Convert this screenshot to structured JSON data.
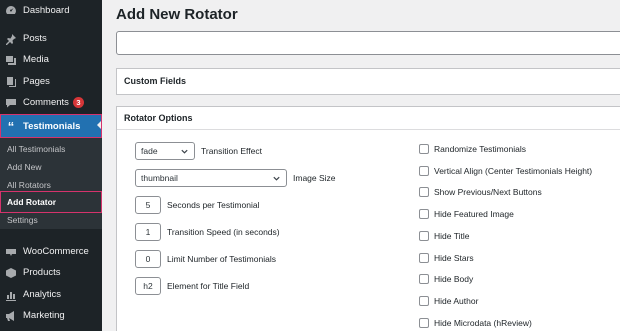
{
  "sidebar": {
    "items": [
      {
        "label": "Dashboard",
        "icon": "dashboard-icon"
      },
      {
        "label": "Posts",
        "icon": "pin-icon"
      },
      {
        "label": "Media",
        "icon": "media-icon"
      },
      {
        "label": "Pages",
        "icon": "pages-icon"
      },
      {
        "label": "Comments",
        "icon": "comments-icon",
        "badge": "3"
      },
      {
        "label": "Testimonials",
        "icon": "quote-icon",
        "active": true
      },
      {
        "label": "WooCommerce",
        "icon": "woocommerce-icon"
      },
      {
        "label": "Products",
        "icon": "products-icon"
      },
      {
        "label": "Analytics",
        "icon": "analytics-icon"
      },
      {
        "label": "Marketing",
        "icon": "marketing-icon"
      }
    ],
    "submenu": [
      {
        "label": "All Testimonials"
      },
      {
        "label": "Add New"
      },
      {
        "label": "All Rotators"
      },
      {
        "label": "Add Rotator",
        "active": true
      },
      {
        "label": "Settings"
      }
    ]
  },
  "page": {
    "title": "Add New Rotator",
    "title_input_value": ""
  },
  "custom_fields": {
    "title": "Custom Fields"
  },
  "rotator_options": {
    "title": "Rotator Options",
    "transition_effect": {
      "value": "fade",
      "label": "Transition Effect"
    },
    "image_size": {
      "value": "thumbnail",
      "label": "Image Size"
    },
    "seconds": {
      "value": "5",
      "label": "Seconds per Testimonial"
    },
    "speed": {
      "value": "1",
      "label": "Transition Speed (in seconds)"
    },
    "limit": {
      "value": "0",
      "label": "Limit Number of Testimonials"
    },
    "element": {
      "value": "h2",
      "label": "Element for Title Field"
    },
    "checkboxes": [
      {
        "label": "Randomize Testimonials",
        "checked": false
      },
      {
        "label": "Vertical Align (Center Testimonials Height)",
        "checked": false
      },
      {
        "label": "Show Previous/Next Buttons",
        "checked": false
      },
      {
        "label": "Hide Featured Image",
        "checked": false
      },
      {
        "label": "Hide Title",
        "checked": false
      },
      {
        "label": "Hide Stars",
        "checked": false
      },
      {
        "label": "Hide Body",
        "checked": false
      },
      {
        "label": "Hide Author",
        "checked": false
      },
      {
        "label": "Hide Microdata (hReview)",
        "checked": false
      }
    ]
  },
  "colors": {
    "sidebar_bg": "#1d2327",
    "submenu_bg": "#2c3338",
    "accent": "#2271b1",
    "highlight_border": "#d6336c",
    "badge": "#d63638"
  }
}
